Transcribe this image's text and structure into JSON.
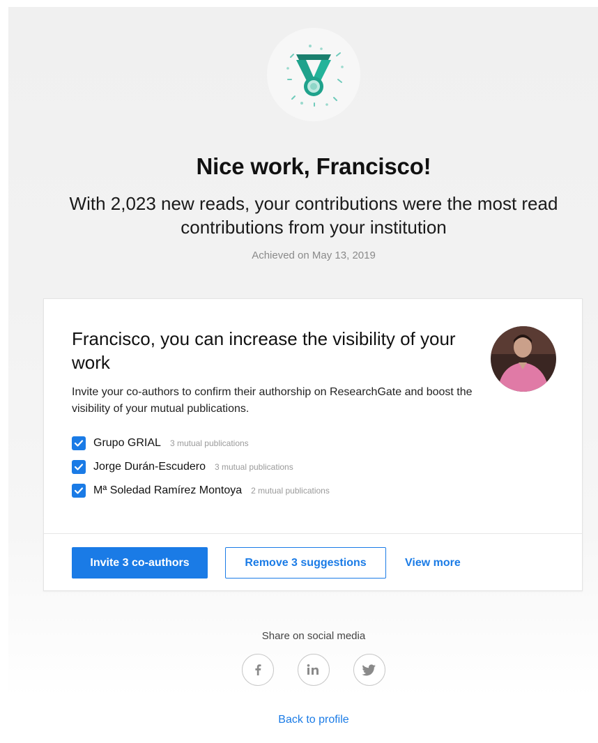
{
  "hero": {
    "icon": "medal-icon",
    "title": "Nice work, Francisco!",
    "subtitle": "With 2,023 new reads, your contributions were the most read contributions from your institution",
    "achieved": "Achieved on May 13, 2019"
  },
  "card": {
    "heading": "Francisco, you can increase the visibility of your work",
    "description": "Invite your co-authors to confirm their authorship on ResearchGate and boost the visibility of your mutual publications.",
    "avatar_icon": "profile-photo",
    "coauthors": [
      {
        "name": "Grupo GRIAL",
        "meta": "3 mutual publications",
        "checked": true
      },
      {
        "name": "Jorge Durán-Escudero",
        "meta": "3 mutual publications",
        "checked": true
      },
      {
        "name": "Mª Soledad Ramírez Montoya",
        "meta": "2 mutual publications",
        "checked": true
      }
    ],
    "invite_label": "Invite 3 co-authors",
    "remove_label": "Remove 3 suggestions",
    "more_label": "View more"
  },
  "share": {
    "label": "Share on social media",
    "icons": [
      "facebook-icon",
      "linkedin-icon",
      "twitter-icon"
    ]
  },
  "footer": {
    "back_label": "Back to profile"
  },
  "colors": {
    "accent": "#1a7be6",
    "medal": "#1fa28c"
  }
}
